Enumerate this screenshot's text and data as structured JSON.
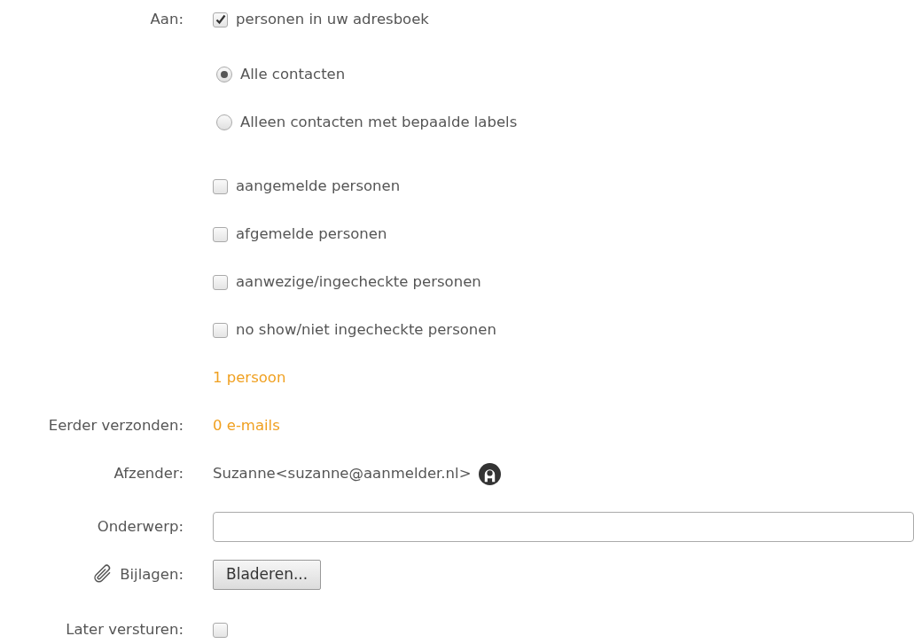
{
  "recipients": {
    "label": "Aan:",
    "items": [
      {
        "label": "personen in uw adresboek",
        "checked": true,
        "options": [
          {
            "label": "Alle contacten",
            "selected": true
          },
          {
            "label": "Alleen contacten met bepaalde labels",
            "selected": false
          }
        ]
      },
      {
        "label": "aangemelde personen",
        "checked": false
      },
      {
        "label": "afgemelde personen",
        "checked": false
      },
      {
        "label": "aanwezige/ingecheckte personen",
        "checked": false
      },
      {
        "label": "no show/niet ingecheckte personen",
        "checked": false
      }
    ],
    "count": "1 persoon"
  },
  "fields": [
    {
      "kind": "count",
      "label": "Eerder verzonden:",
      "value": "0 e-mails"
    },
    {
      "kind": "sender",
      "label": "Afzender:",
      "value": "Suzanne<suzanne@aanmelder.nl>"
    },
    {
      "kind": "input",
      "label": "Onderwerp:"
    },
    {
      "kind": "file",
      "label": "Bijlagen:",
      "button": "Bladeren..."
    },
    {
      "kind": "checkbox",
      "label": "Later versturen:",
      "checked": false
    }
  ]
}
